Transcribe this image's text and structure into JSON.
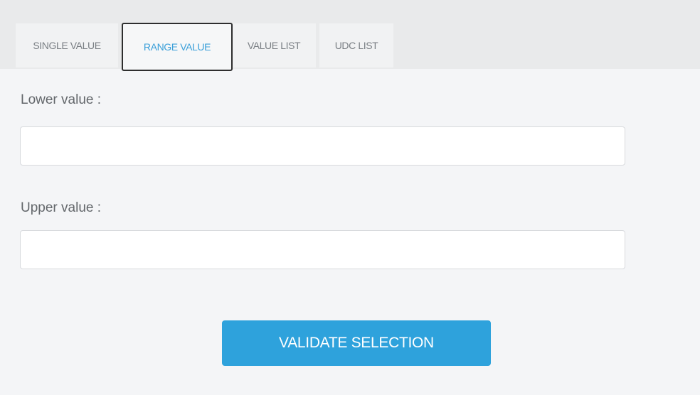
{
  "tabs": [
    {
      "label": "SINGLE VALUE"
    },
    {
      "label": "RANGE VALUE",
      "active": true
    },
    {
      "label": "VALUE LIST"
    },
    {
      "label": "UDC LIST"
    }
  ],
  "form": {
    "lower_label": "Lower value :",
    "lower_value": "",
    "upper_label": "Upper value :",
    "upper_value": ""
  },
  "actions": {
    "validate_label": "VALIDATE SELECTION"
  },
  "colors": {
    "accent": "#2ea2dc",
    "active_tab_text": "#3a9fd9",
    "panel_background": "#f4f5f7"
  }
}
